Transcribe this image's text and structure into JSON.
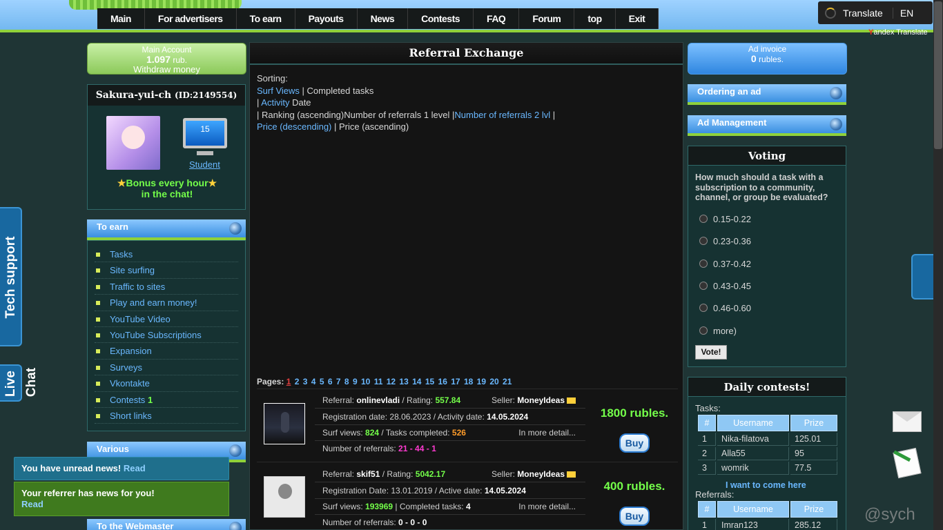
{
  "topnav": [
    "Main",
    "For advertisers",
    "To earn",
    "Payouts",
    "News",
    "Contests",
    "FAQ",
    "Forum",
    "top",
    "Exit"
  ],
  "translate": {
    "label": "Translate",
    "lang": "EN",
    "brand_first": "Y",
    "brand_rest": "andex Translate"
  },
  "account": {
    "title": "Main Account",
    "balance": "1.097",
    "unit": "rub.",
    "withdraw": "Withdraw money"
  },
  "user": {
    "name": "Sakura-yui-ch",
    "id": "(ID:2149554)",
    "level": "15",
    "rank": "Student",
    "bonus_line1": "Bonus every hour",
    "bonus_line2": "in the chat!"
  },
  "earn_menu": {
    "title": "To earn",
    "items": [
      "Tasks",
      "Site surfing",
      "Traffic to sites",
      "Play and earn money!",
      "YouTube Video",
      "YouTube Subscriptions",
      "Expansion",
      "Surveys",
      "Vkontakte",
      "Contests",
      "Short links"
    ],
    "contests_count": "1"
  },
  "various_title": "Various",
  "webmaster_title": "To the Webmaster",
  "notices": {
    "news": "You have unread news!",
    "news_link": "Read",
    "ref": "Your referrer has news for you!",
    "ref_link": "Read"
  },
  "side": {
    "tech": "Tech support",
    "live": "Live",
    "chat": "Chat"
  },
  "center": {
    "title": "Referral Exchange",
    "sorting_label": "Sorting:",
    "s_surf": "Surf Views",
    "s_completed": "Completed tasks",
    "s_activity": "Activity",
    "s_date": "Date",
    "s_ranking": "Ranking (ascending)",
    "s_ref1": "Number of referrals 1 level",
    "s_ref2": "Number of referrals 2 lvl",
    "s_price_desc": "Price (descending)",
    "s_price_asc": "Price (ascending)",
    "pages_label": "Pages:",
    "pages": [
      "1",
      "2",
      "3",
      "4",
      "5",
      "6",
      "7",
      "8",
      "9",
      "10",
      "11",
      "12",
      "13",
      "14",
      "15",
      "16",
      "17",
      "18",
      "19",
      "20",
      "21"
    ]
  },
  "referrals": [
    {
      "ref_label": "Referral:",
      "name": "onlinevladi",
      "rating_label": "/ Rating:",
      "rating": "557.84",
      "seller_label": "Seller:",
      "seller": "MoneyIdeas",
      "reg_label": "Registration date: 28.06.2023 / Activity date:",
      "activity": "14.05.2024",
      "surf_label": "Surf views:",
      "surf": "824",
      "tasks_label": "/ Tasks completed:",
      "tasks": "526",
      "more": "In more detail...",
      "refs_label": "Number of referrals:",
      "refs": "21 - 44 - 1",
      "price": "1800 rubles.",
      "buy": "Buy"
    },
    {
      "ref_label": "Referral:",
      "name": "skif51",
      "rating_label": "/ Rating:",
      "rating": "5042.17",
      "seller_label": "Seller:",
      "seller": "MoneyIdeas",
      "reg_label": "Registration Date: 13.01.2019 / Active date:",
      "activity": "14.05.2024",
      "surf_label": "Surf views:",
      "surf": "193969",
      "tasks_label": "| Completed tasks:",
      "tasks": "4",
      "more": "In more detail...",
      "refs_label": "Number of referrals:",
      "refs": "0 - 0 - 0",
      "price": "400 rubles.",
      "buy": "Buy"
    }
  ],
  "ad": {
    "invoice_title": "Ad invoice",
    "invoice_amount": "0",
    "invoice_unit": "rubles.",
    "order": "Ordering an ad",
    "manage": "Ad Management"
  },
  "voting": {
    "title": "Voting",
    "question": "How much should a task with a subscription to a community, channel, or group be evaluated?",
    "options": [
      "0.15-0.22",
      "0.23-0.36",
      "0.37-0.42",
      "0.43-0.45",
      "0.46-0.60",
      "more)"
    ],
    "button": "Vote!"
  },
  "daily": {
    "title": "Daily contests!",
    "tasks_label": "Tasks:",
    "headers": [
      "#",
      "Username",
      "Prize"
    ],
    "tasks": [
      [
        "1",
        "Nika-filatova",
        "125.01"
      ],
      [
        "2",
        "Alla55",
        "95"
      ],
      [
        "3",
        "womrik",
        "77.5"
      ]
    ],
    "want": "I want to come here",
    "refs_label": "Referrals:",
    "refs": [
      [
        "1",
        "Imran123",
        "285.12"
      ]
    ]
  },
  "watermark": "@sych"
}
